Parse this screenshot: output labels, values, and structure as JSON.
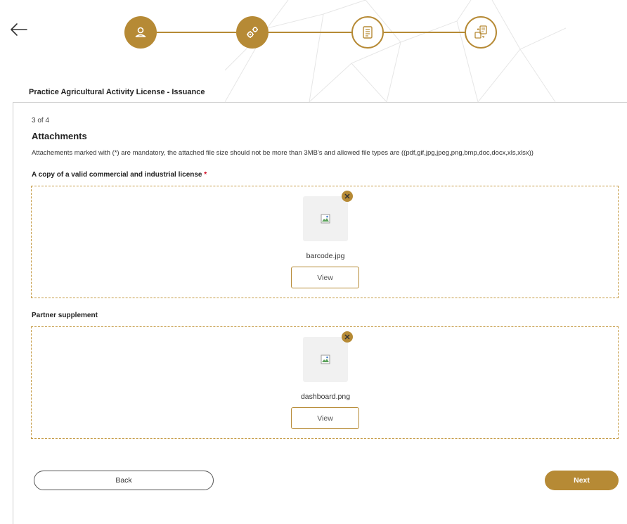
{
  "colors": {
    "accent": "#b68a35",
    "required": "#d0021b"
  },
  "header": {
    "service_title": "Practice Agricultural Activity License - Issuance",
    "steps": [
      {
        "icon": "user-icon",
        "status": "completed"
      },
      {
        "icon": "gears-icon",
        "status": "completed"
      },
      {
        "icon": "document-list-icon",
        "status": "current"
      },
      {
        "icon": "document-exchange-icon",
        "status": "pending"
      }
    ]
  },
  "form": {
    "step_count": "3 of 4",
    "section_title": "Attachments",
    "note": "Attachements marked with (*) are mandatory, the attached file size should not be more than 3MB's and allowed file types are ((pdf,gif,jpg,jpeg,png,bmp,doc,docx,xls,xlsx))",
    "attachments": [
      {
        "label": "A copy of a valid commercial and industrial license",
        "required_mark": "*",
        "file_name": "barcode.jpg",
        "view_label": "View"
      },
      {
        "label": "Partner supplement",
        "required_mark": "",
        "file_name": "dashboard.png",
        "view_label": "View"
      }
    ]
  },
  "footer": {
    "back_label": "Back",
    "next_label": "Next"
  }
}
